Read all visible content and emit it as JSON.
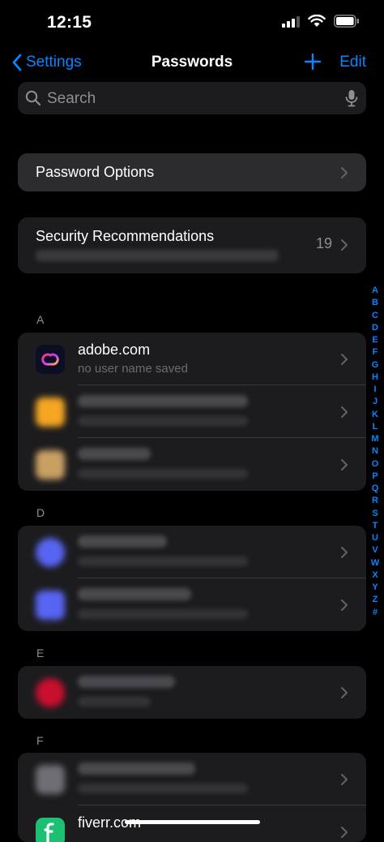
{
  "status": {
    "time": "12:15"
  },
  "nav": {
    "back_label": "Settings",
    "title": "Passwords",
    "edit_label": "Edit"
  },
  "search": {
    "placeholder": "Search"
  },
  "password_options": {
    "label": "Password Options"
  },
  "security": {
    "label": "Security Recommendations",
    "count": "19"
  },
  "sections": {
    "a": "A",
    "d": "D",
    "e": "E",
    "f": "F"
  },
  "accounts": {
    "adobe": {
      "title": "adobe.com",
      "subtitle": "no user name saved"
    },
    "fiverr": {
      "title": "fiverr.com"
    }
  },
  "alphabet": [
    "A",
    "B",
    "C",
    "D",
    "E",
    "F",
    "G",
    "H",
    "I",
    "J",
    "K",
    "L",
    "M",
    "N",
    "O",
    "P",
    "Q",
    "R",
    "S",
    "T",
    "U",
    "V",
    "W",
    "X",
    "Y",
    "Z",
    "#"
  ],
  "colors": {
    "accent": "#0a84ff",
    "row_bg": "#1c1c1e",
    "background": "#000000"
  }
}
